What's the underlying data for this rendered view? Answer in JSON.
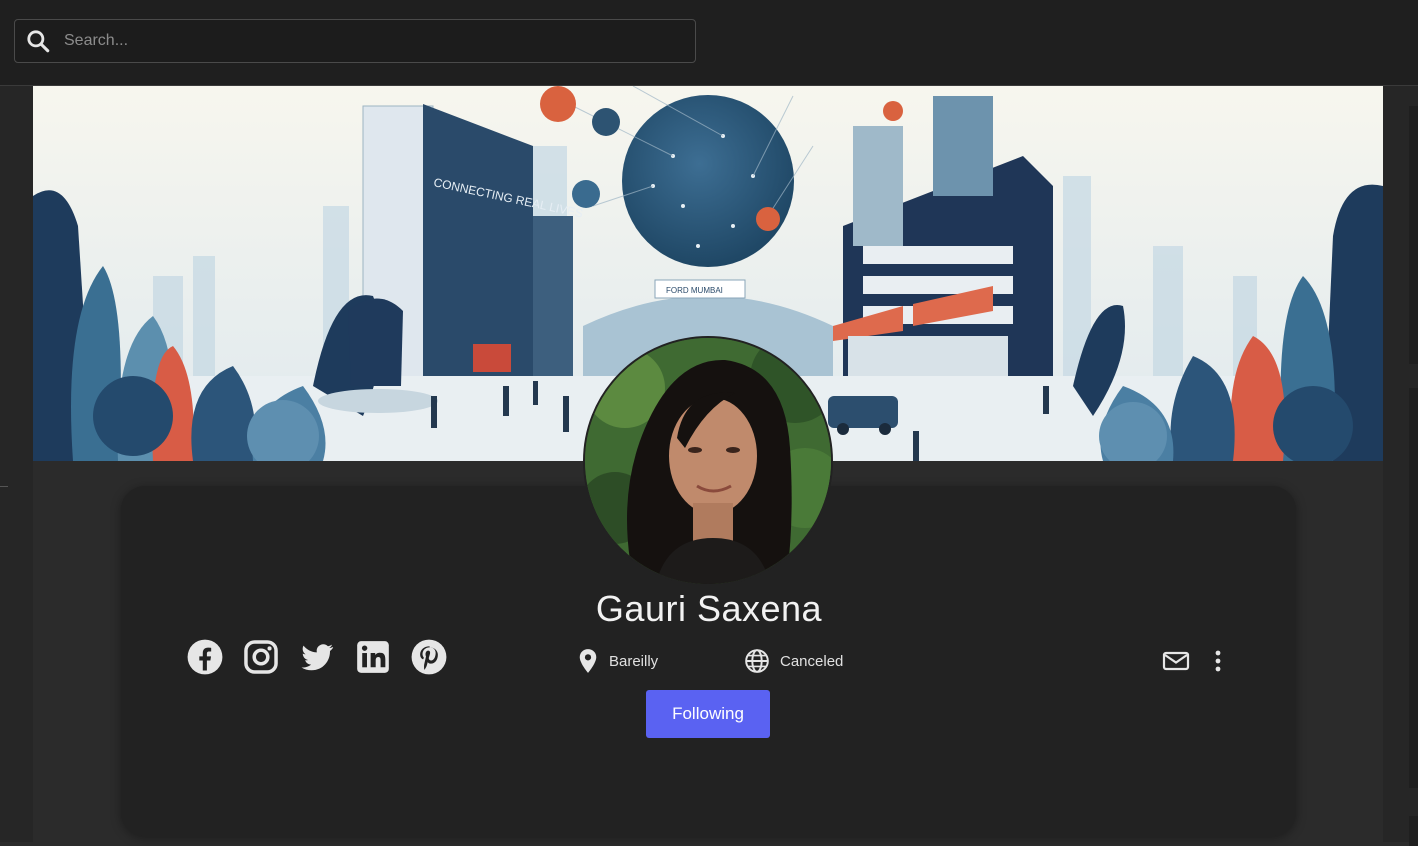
{
  "search": {
    "placeholder": "Search..."
  },
  "cover": {
    "billboard_text": "CONNECTING REAL LIVES",
    "sign_text": "FORD MUMBAI"
  },
  "profile": {
    "name": "Gauri Saxena",
    "location": "Bareilly",
    "website": "Canceled",
    "follow_label": "Following"
  },
  "socials": [
    "facebook-icon",
    "instagram-icon",
    "twitter-icon",
    "linkedin-icon",
    "pinterest-icon"
  ],
  "colors": {
    "accent": "#5a62f2",
    "card_bg": "#222222",
    "page_bg": "#2b2b2b",
    "topbar_bg": "#1f1f1f"
  }
}
